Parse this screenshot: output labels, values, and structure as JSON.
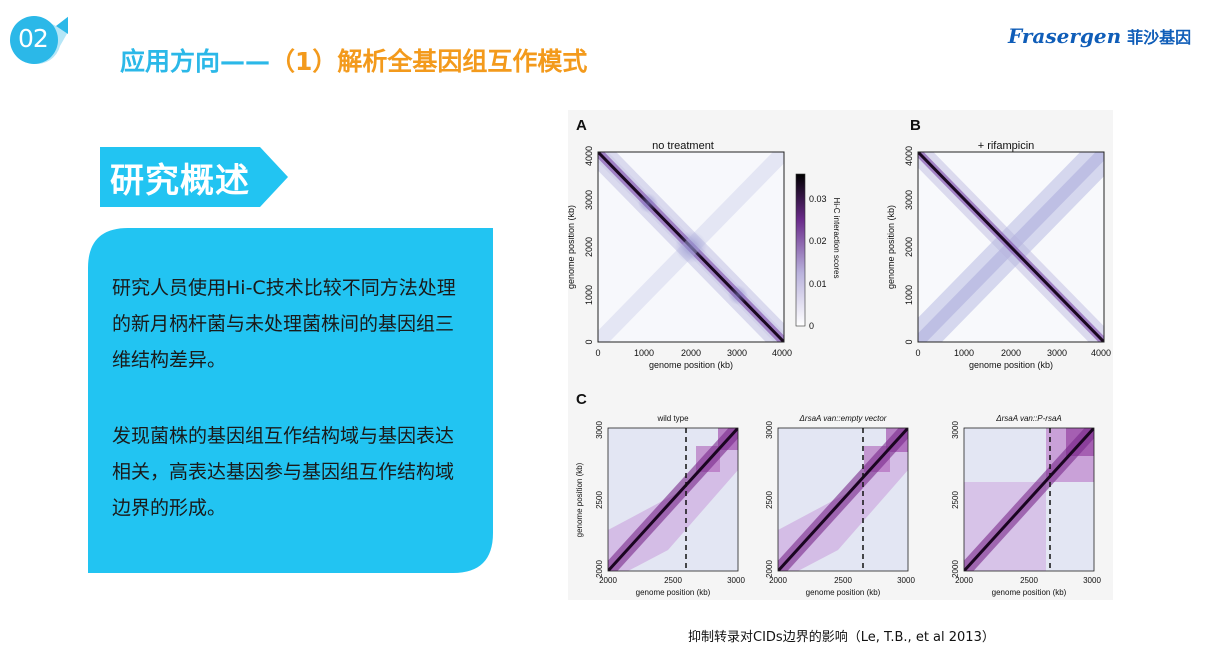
{
  "header": {
    "badge_number": "02",
    "title_main": "应用方向——",
    "title_sub": "（1）解析全基因组互作模式",
    "brand_en": "Frasergen",
    "brand_cn": "菲沙基因",
    "colors": {
      "blue": "#2bb8e8",
      "orange": "#f39a1c",
      "brand": "#0f5db8"
    }
  },
  "summary": {
    "tag": "研究概述",
    "paragraph1": "研究人员使用Hi-C技术比较不同方法处理的新月柄杆菌与未处理菌株间的基因组三维结构差异。",
    "paragraph2": "发现菌株的基因组互作结构域与基因表达相关，高表达基因参与基因组互作结构域边界的形成。",
    "panel_color": "#22c4f2"
  },
  "figure": {
    "panel_a": {
      "letter": "A",
      "title": "no treatment",
      "xlabel": "genome position (kb)",
      "ylabel": "genome position (kb)",
      "ticks": [
        "0",
        "1000",
        "2000",
        "3000",
        "4000"
      ]
    },
    "panel_b": {
      "letter": "B",
      "title": "+ rifampicin",
      "xlabel": "genome position (kb)",
      "ylabel": "genome position (kb)",
      "ticks": [
        "0",
        "1000",
        "2000",
        "3000",
        "4000"
      ]
    },
    "colorbar": {
      "label": "Hi-C interaction scores",
      "ticks": [
        "0.03",
        "0.02",
        "0.01",
        "0"
      ]
    },
    "panel_c": {
      "letter": "C",
      "xlabel": "genome position (kb)",
      "ylabel": "genome position (kb)",
      "ticks": [
        "2000",
        "2500",
        "3000"
      ],
      "subtitles": [
        "wild type",
        "ΔrsaA van::empty vector",
        "ΔrsaA van::P-rsaA"
      ]
    }
  },
  "caption": "抑制转录对CIDs边界的影响（Le, T.B., et al 2013）"
}
